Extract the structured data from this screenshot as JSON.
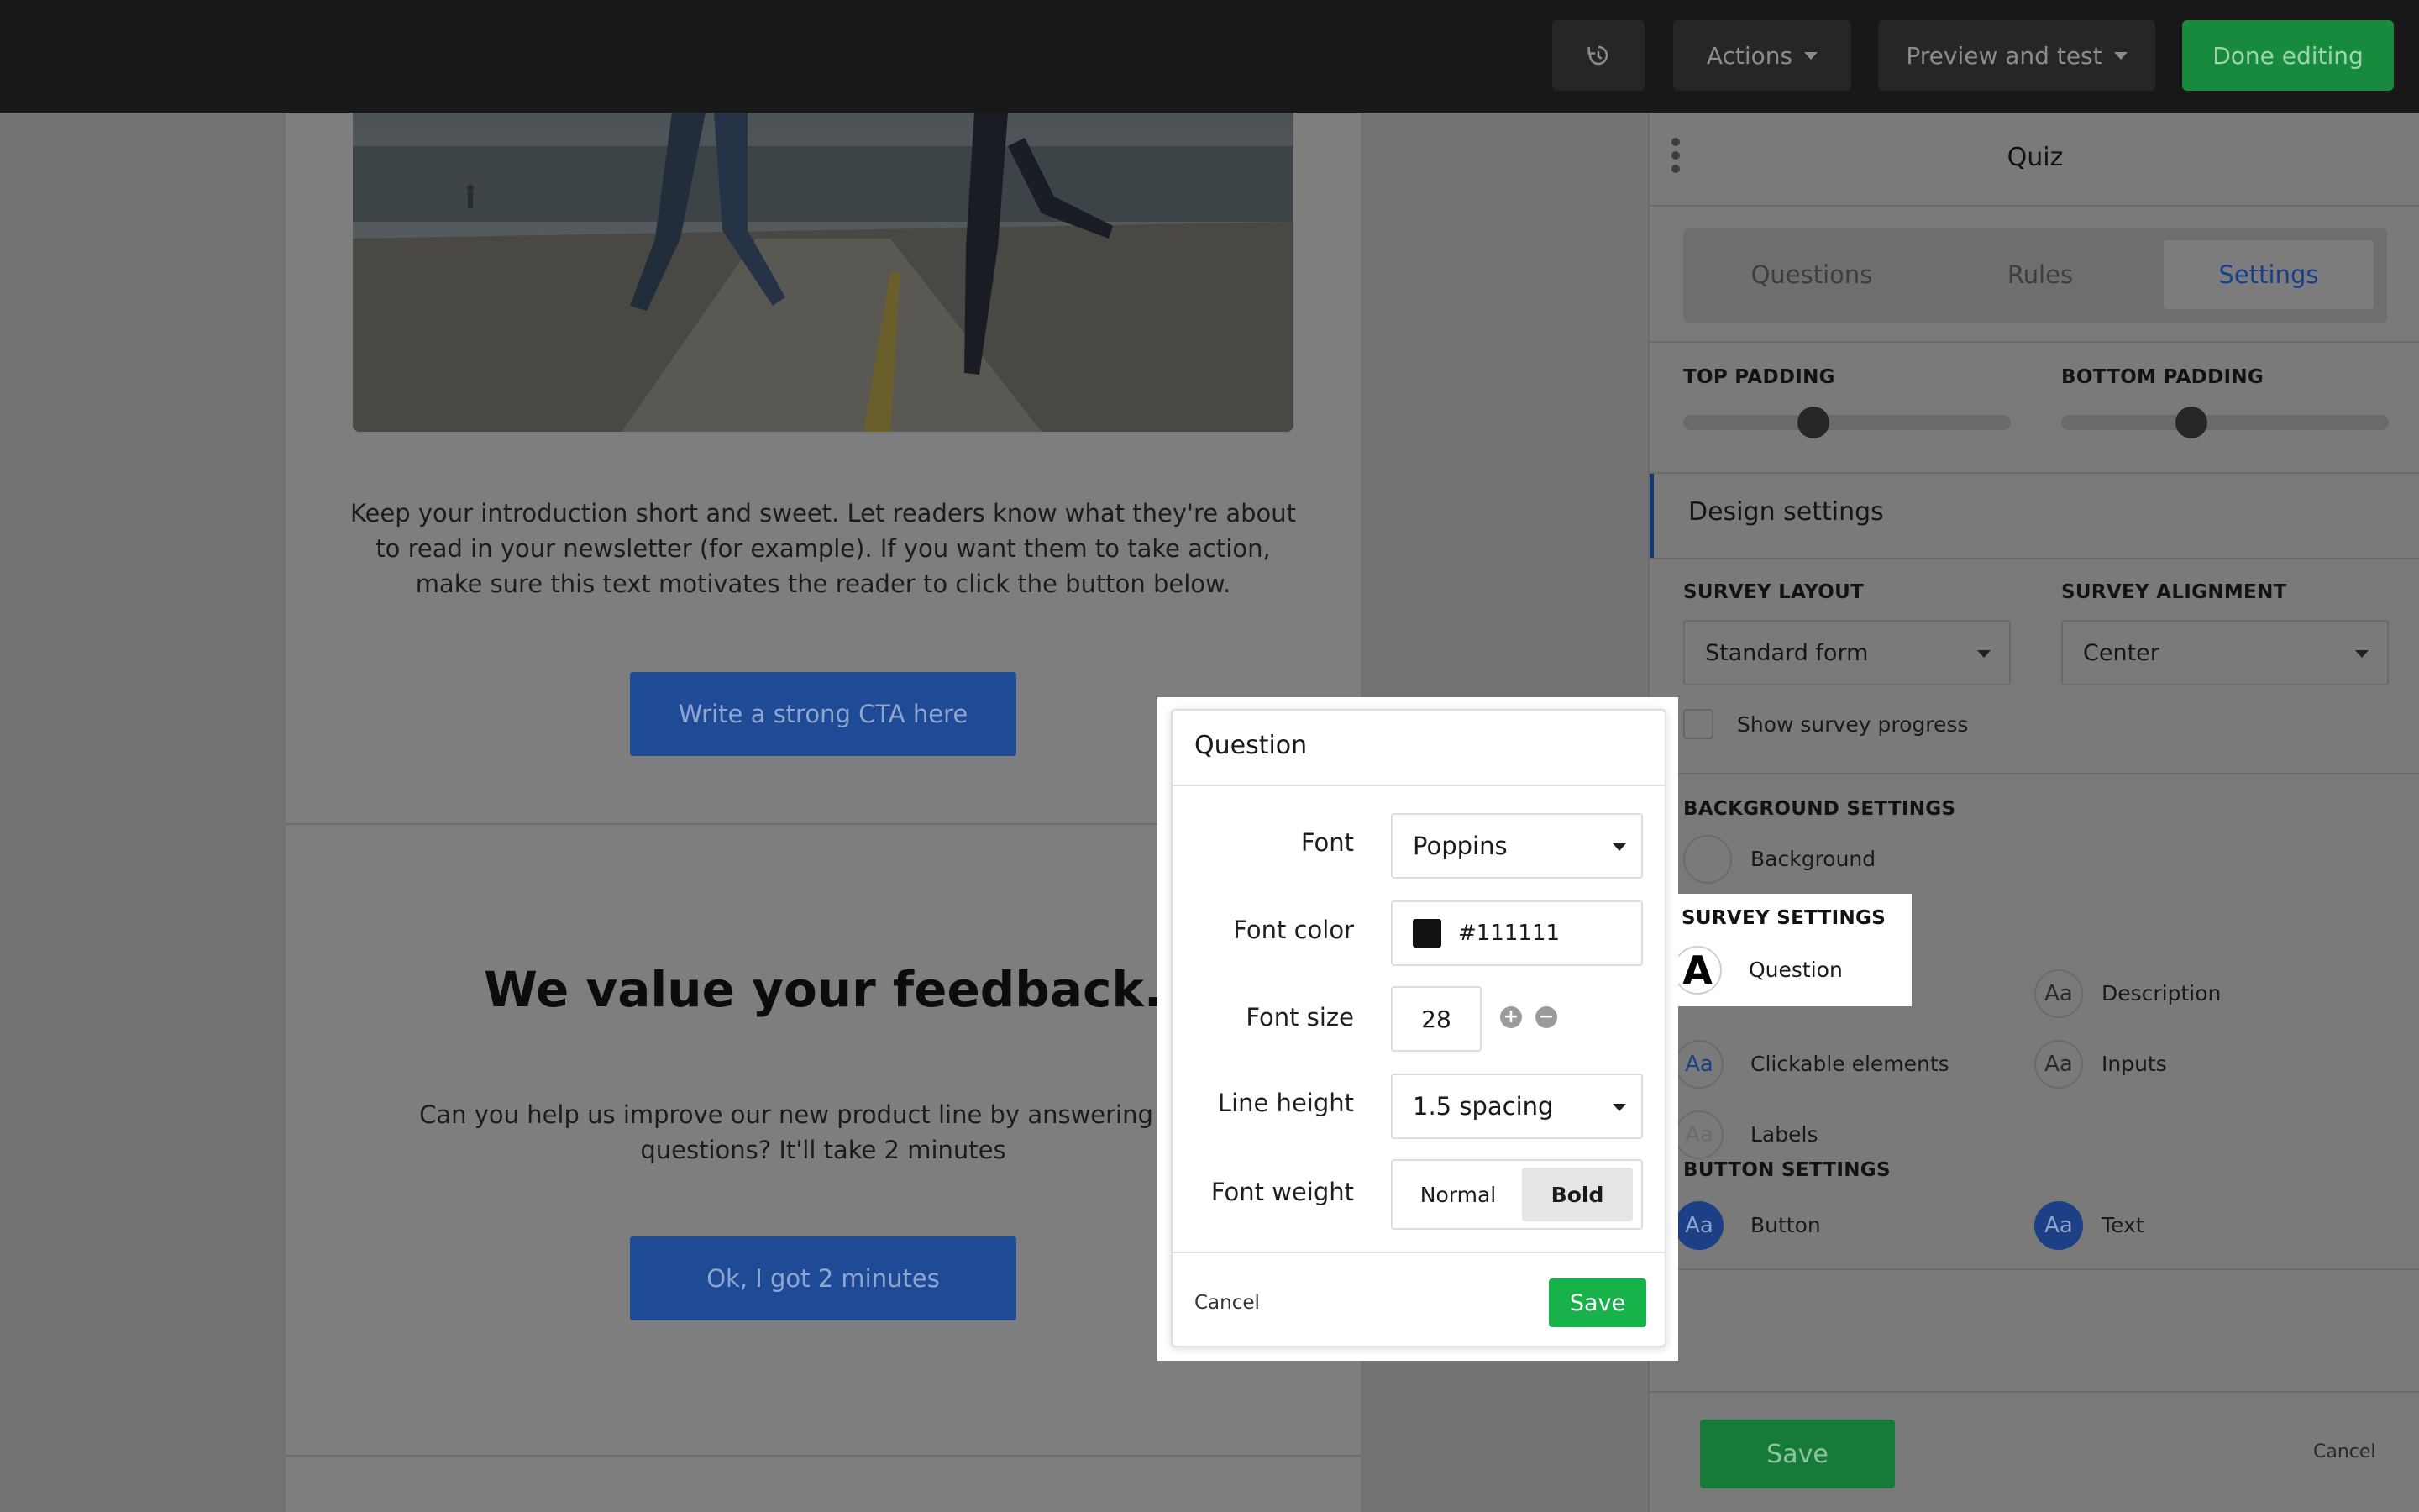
{
  "topbar": {
    "history_icon": "history-icon",
    "actions_label": "Actions",
    "preview_label": "Preview and test",
    "done_label": "Done editing"
  },
  "email": {
    "intro_text": "Keep your introduction short and sweet. Let readers know what they're about to read in your newsletter (for example). If you want them to take action, make sure this text motivates the reader to click the button below.",
    "cta_label": "Write a strong CTA here",
    "feedback_title": "We value your feedback.",
    "feedback_text": "Can you help us improve our new product line by answering a few questions? It'll take 2 minutes",
    "feedback_button": "Ok, I got 2 minutes"
  },
  "panel": {
    "title": "Quiz",
    "tabs": [
      {
        "label": "Questions",
        "active": false
      },
      {
        "label": "Rules",
        "active": false
      },
      {
        "label": "Settings",
        "active": true
      }
    ],
    "top_padding_label": "TOP PADDING",
    "bottom_padding_label": "BOTTOM PADDING",
    "top_padding_level": 0.4,
    "bottom_padding_level": 0.4,
    "design_settings_label": "Design settings",
    "survey_layout_label": "SURVEY LAYOUT",
    "survey_layout_value": "Standard form",
    "survey_alignment_label": "SURVEY ALIGNMENT",
    "survey_alignment_value": "Center",
    "show_progress_label": "Show survey progress",
    "show_progress_checked": false,
    "background_settings_label": "BACKGROUND SETTINGS",
    "background_label": "Background",
    "survey_settings_label": "SURVEY SETTINGS",
    "aa_glyph": "Aa",
    "question_glyph": "A",
    "question_label": "Question",
    "description_label": "Description",
    "clickable_label": "Clickable elements",
    "inputs_label": "Inputs",
    "labels_label": "Labels",
    "button_settings_label": "BUTTON SETTINGS",
    "button_label": "Button",
    "text_label": "Text",
    "save_label": "Save",
    "cancel_label": "Cancel"
  },
  "popup": {
    "title": "Question",
    "font_label": "Font",
    "font_value": "Poppins",
    "font_color_label": "Font color",
    "font_color_value": "#111111",
    "font_size_label": "Font size",
    "font_size_value": "28",
    "plus_glyph": "+",
    "minus_glyph": "−",
    "line_height_label": "Line height",
    "line_height_value": "1.5 spacing",
    "font_weight_label": "Font weight",
    "weight_normal": "Normal",
    "weight_bold": "Bold",
    "weight_selected": "Bold",
    "cancel_label": "Cancel",
    "save_label": "Save"
  },
  "colors": {
    "accent_blue": "#1f4a96",
    "save_green": "#18b24b",
    "swatch": "#111111"
  }
}
